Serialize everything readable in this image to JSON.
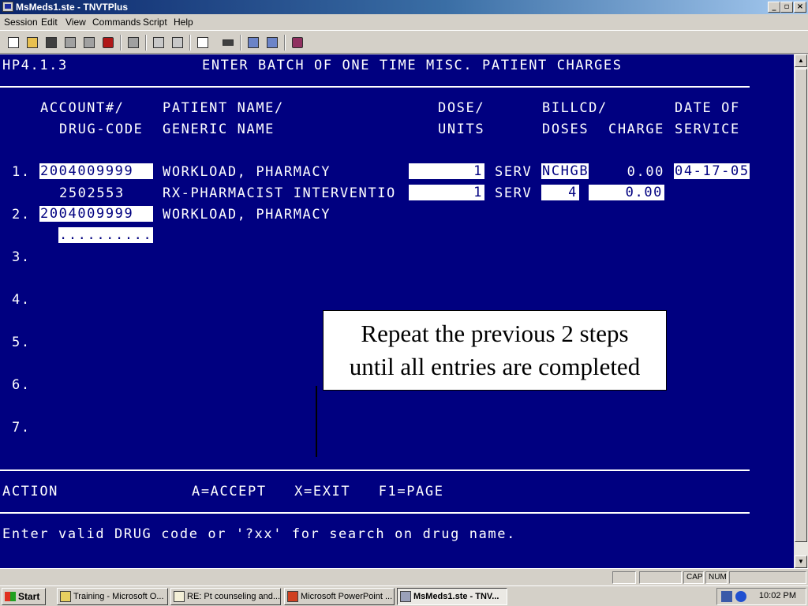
{
  "window": {
    "title": "MsMeds1.ste - TNVTPlus"
  },
  "menu": [
    "Session",
    "Edit",
    "View",
    "Commands",
    "Script",
    "Help"
  ],
  "terminal": {
    "screen_id": "HP4.1.3",
    "screen_title": "ENTER BATCH OF ONE TIME MISC. PATIENT CHARGES",
    "headers": {
      "account": "ACCOUNT#/",
      "drug_code": "DRUG-CODE",
      "patient_name": "PATIENT NAME/",
      "generic_name": "GENERIC NAME",
      "dose": "DOSE/",
      "units": "UNITS",
      "billcd": "BILLCD/",
      "doses": "DOSES",
      "charge": "CHARGE",
      "date_of": "DATE OF",
      "service": "SERVICE"
    },
    "rows": [
      {
        "num": "1.",
        "account": "2004009999",
        "patient": "WORKLOAD, PHARMACY",
        "dose": "1",
        "unit": "SERV",
        "billcd": "NCHGB",
        "charge": "0.00",
        "date": "04-17-05"
      },
      {
        "drug_code": "2502553",
        "generic": "RX-PHARMACIST INTERVENTIO",
        "dose": "1",
        "unit": "SERV",
        "doses": "4",
        "charge": "0.00"
      },
      {
        "num": "2.",
        "account": "2004009999",
        "patient": "WORKLOAD, PHARMACY"
      },
      {
        "drug_code_input": ".........."
      }
    ],
    "empty_rows": [
      "3.",
      "4.",
      "5.",
      "6.",
      "7."
    ],
    "action_label": "ACTION",
    "action_keys": "A=ACCEPT   X=EXIT   F1=PAGE",
    "message": "Enter valid DRUG code or '?xx' for search on drug name."
  },
  "callout": {
    "line1": "Repeat the previous 2 steps",
    "line2": "until all entries  are completed"
  },
  "statusbar": {
    "cap": "CAP",
    "num": "NUM"
  },
  "taskbar": {
    "start": "Start",
    "tasks": [
      "Training - Microsoft O...",
      "RE: Pt counseling and...",
      "Microsoft PowerPoint ...",
      "MsMeds1.ste - TNV..."
    ],
    "clock": "10:02 PM"
  },
  "colors": {
    "terminal_bg": "#000080",
    "terminal_fg": "#ffffff",
    "title_bar": "#0a246a"
  }
}
